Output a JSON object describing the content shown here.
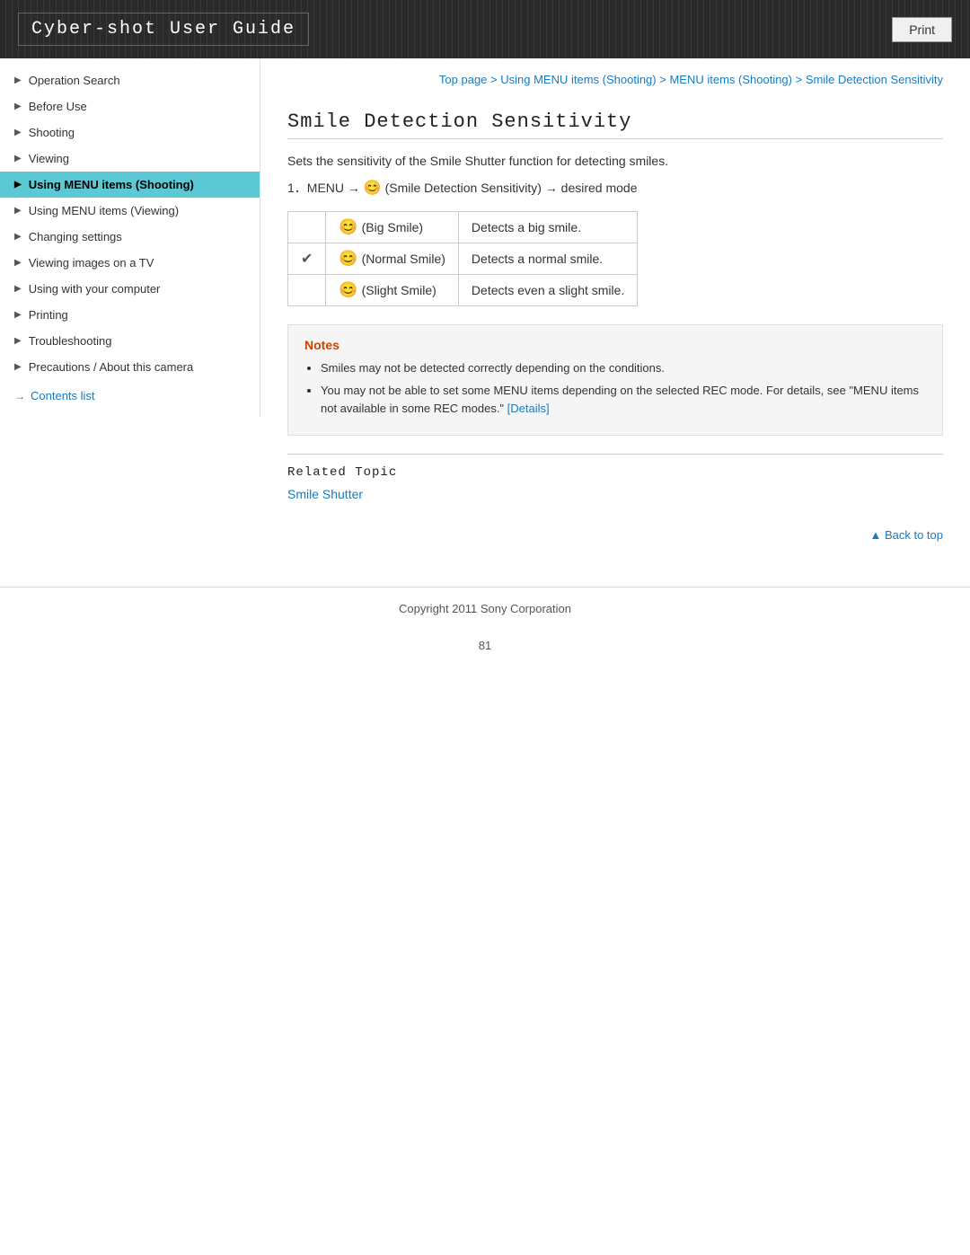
{
  "header": {
    "title": "Cyber-shot User Guide",
    "print_label": "Print"
  },
  "breadcrumb": {
    "parts": [
      {
        "label": "Top page",
        "href": "#"
      },
      {
        "label": "Using MENU items (Shooting)",
        "href": "#"
      },
      {
        "label": "MENU items (Shooting)",
        "href": "#"
      },
      {
        "label": "Smile Detection Sensitivity",
        "href": "#"
      }
    ],
    "separator": " > "
  },
  "page_title": "Smile Detection Sensitivity",
  "description": "Sets the sensitivity of the Smile Shutter function for detecting smiles.",
  "step_instruction": "1．MENU → 😊 (Smile Detection Sensitivity) → desired mode",
  "table": {
    "rows": [
      {
        "icon": "😊",
        "checked": false,
        "label": "(Big Smile)",
        "description": "Detects a big smile."
      },
      {
        "icon": "😊",
        "checked": true,
        "label": "(Normal Smile)",
        "description": "Detects a normal smile."
      },
      {
        "icon": "😊",
        "checked": false,
        "label": "(Slight Smile)",
        "description": "Detects even a slight smile."
      }
    ]
  },
  "notes": {
    "title": "Notes",
    "items": [
      "Smiles may not be detected correctly depending on the conditions.",
      "You may not be able to set some MENU items depending on the selected REC mode. For details, see \"MENU items not available in some REC modes.\""
    ],
    "details_link_label": "[Details]",
    "details_href": "#"
  },
  "related_topic": {
    "title": "Related Topic",
    "link_label": "Smile Shutter",
    "link_href": "#"
  },
  "back_to_top_label": "▲ Back to top",
  "footer": {
    "copyright": "Copyright 2011 Sony Corporation"
  },
  "page_number": "81",
  "sidebar": {
    "items": [
      {
        "label": "Operation Search",
        "active": false
      },
      {
        "label": "Before Use",
        "active": false
      },
      {
        "label": "Shooting",
        "active": false
      },
      {
        "label": "Viewing",
        "active": false
      },
      {
        "label": "Using MENU items (Shooting)",
        "active": true
      },
      {
        "label": "Using MENU items (Viewing)",
        "active": false
      },
      {
        "label": "Changing settings",
        "active": false
      },
      {
        "label": "Viewing images on a TV",
        "active": false
      },
      {
        "label": "Using with your computer",
        "active": false
      },
      {
        "label": "Printing",
        "active": false
      },
      {
        "label": "Troubleshooting",
        "active": false
      },
      {
        "label": "Precautions / About this camera",
        "active": false
      }
    ],
    "contents_list_label": "Contents list"
  }
}
